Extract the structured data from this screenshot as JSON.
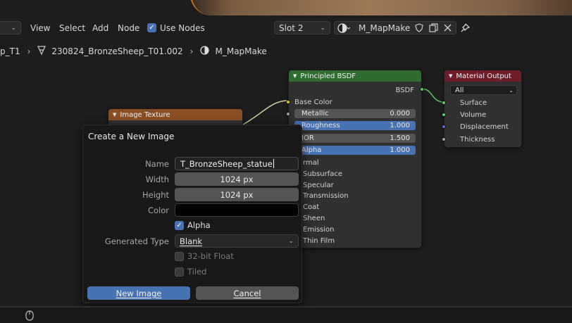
{
  "header": {
    "mode_dropdown": "",
    "menu": [
      "View",
      "Select",
      "Add",
      "Node"
    ],
    "use_nodes_label": "Use Nodes",
    "use_nodes_checked": true,
    "slot_label": "Slot 2",
    "material_name": "M_MapMake"
  },
  "breadcrumb": {
    "items": [
      "p_T1",
      "230824_BronzeSheep_T01.002",
      "M_MapMake"
    ]
  },
  "nodes": {
    "image_texture": {
      "title": "Image Texture",
      "color": "#8a4e24"
    },
    "principled": {
      "title": "Principled BSDF",
      "color": "#2e6d2f",
      "output": "BSDF",
      "base_color": "Base Color",
      "fields": [
        {
          "label": "Metallic",
          "value": "0.000"
        },
        {
          "label": "Roughness",
          "value": "1.000"
        },
        {
          "label": "IOR",
          "value": "1.500"
        },
        {
          "label": "Alpha",
          "value": "1.000"
        }
      ],
      "panels": [
        "rmal",
        "Subsurface",
        "Specular",
        "Transmission",
        "Coat",
        "Sheen",
        "Emission",
        "Thin Film"
      ]
    },
    "material_output": {
      "title": "Material Output",
      "color": "#6e1e2a",
      "target": "All",
      "inputs": [
        "Surface",
        "Volume",
        "Displacement",
        "Thickness"
      ]
    }
  },
  "dialog": {
    "title": "Create a New Image",
    "name_label": "Name",
    "name_value": "T_BronzeSheep_statue",
    "width_label": "Width",
    "width_value": "1024 px",
    "height_label": "Height",
    "height_value": "1024 px",
    "color_label": "Color",
    "color_value": "#000000",
    "alpha_label": "Alpha",
    "alpha_checked": true,
    "generated_type_label": "Generated Type",
    "generated_type_value": "Blank",
    "float_label": "32-bit Float",
    "float_checked": false,
    "tiled_label": "Tiled",
    "tiled_checked": false,
    "ok_label": "New Image",
    "cancel_label": "Cancel"
  },
  "colors": {
    "accent": "#4772b3",
    "socket_yellow": "#c7c729",
    "socket_green": "#63c763",
    "socket_grey": "#a1a1a1",
    "socket_purple": "#6363c7"
  }
}
